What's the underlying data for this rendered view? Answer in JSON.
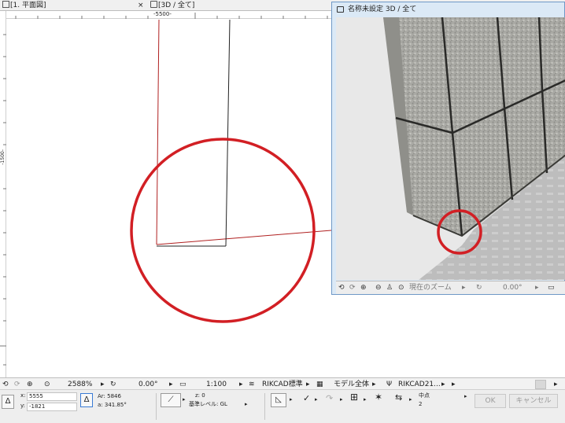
{
  "tabs": [
    {
      "label": "[1. 平面図]",
      "close": "×"
    },
    {
      "label": "[3D / 全て]"
    }
  ],
  "ruler": {
    "top_label": "-5500-",
    "left_label": "-1500-"
  },
  "window3d": {
    "title": "名称未設定 3D / 全て",
    "zoom_label": "現在のズーム",
    "angle": "0.00°"
  },
  "status": {
    "zoom": "2588%",
    "angle": "0.00°",
    "scale": "1:100",
    "layer": "RIKCAD標準",
    "model": "モデル全体",
    "pen": "RIKCAD21..."
  },
  "infobox": {
    "x": "5555",
    "y": "-1821",
    "x_prefix": "x:",
    "y_prefix": "y:",
    "ar": "Ar: 5846",
    "angle": "a: 341.85°",
    "z": "z: 0",
    "ref_level": "基準レベル: GL",
    "snap_label": "中点",
    "snap_value": "2",
    "ok": "OK",
    "cancel": "キャンセル"
  },
  "colors": {
    "annotation_circle": "#d21f24",
    "plan_line_red": "#b02020",
    "window_frame": "#6f98c6"
  }
}
